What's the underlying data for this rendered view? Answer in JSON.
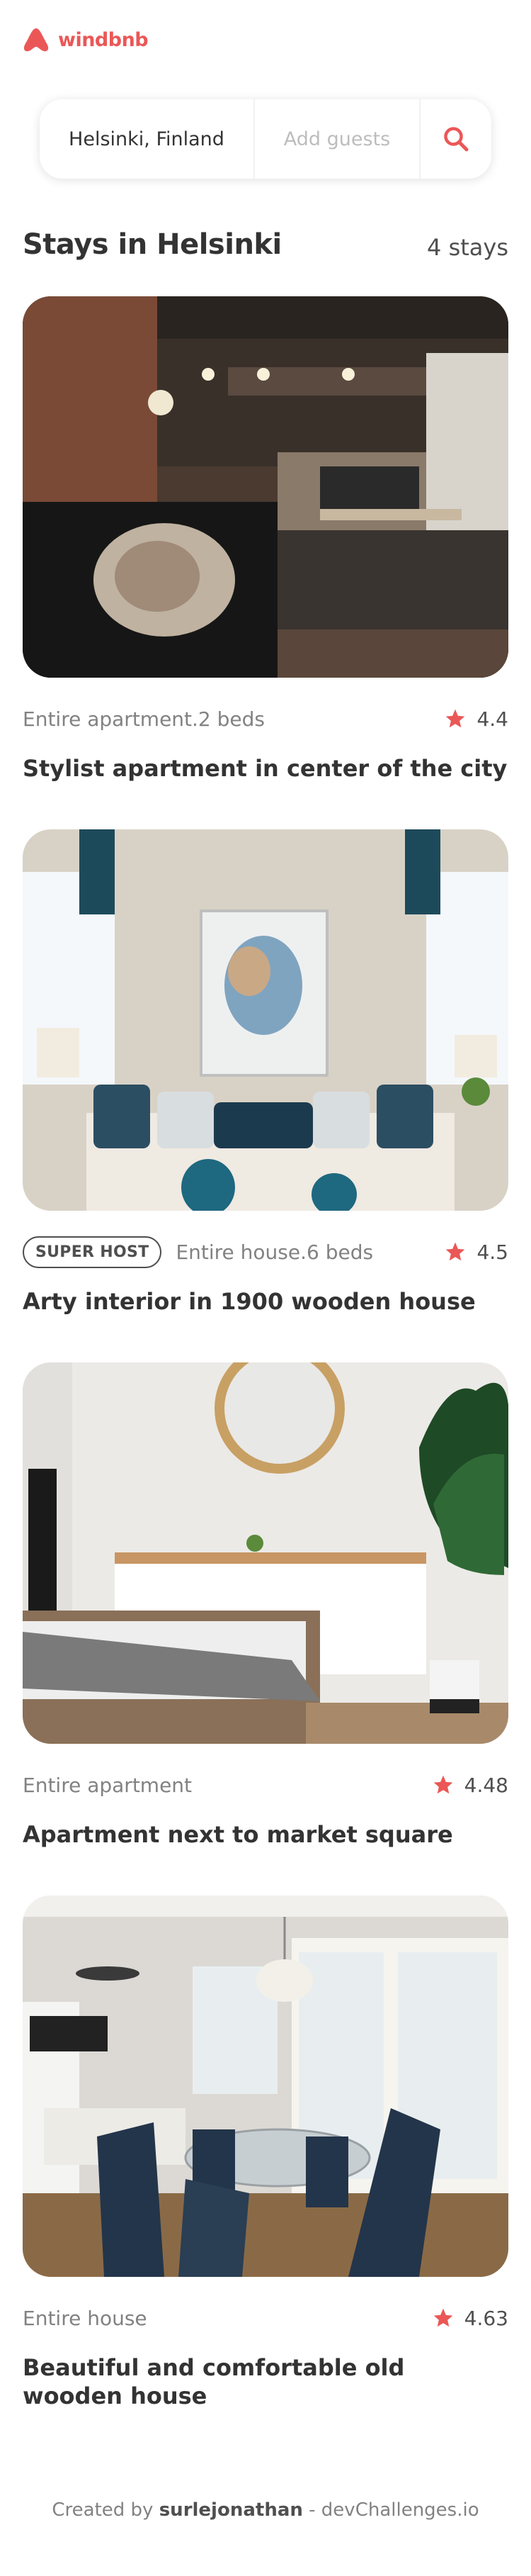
{
  "app": {
    "name": "windbnb"
  },
  "search": {
    "location": "Helsinki, Finland",
    "guests_placeholder": "Add guests"
  },
  "heading": {
    "title": "Stays in Helsinki",
    "count": "4 stays"
  },
  "stays": [
    {
      "superhost": false,
      "type": "Entire apartment.2 beds",
      "rating": "4.4",
      "title": "Stylist apartment in center of the city"
    },
    {
      "superhost": true,
      "superhost_label": "SUPER HOST",
      "type": "Entire house.6 beds",
      "rating": "4.5",
      "title": "Arty interior in 1900 wooden house"
    },
    {
      "superhost": false,
      "type": "Entire apartment",
      "rating": "4.48",
      "title": "Apartment next to market square"
    },
    {
      "superhost": false,
      "type": "Entire house",
      "rating": "4.63",
      "title": "Beautiful and comfortable old wooden house"
    }
  ],
  "footer": {
    "prefix": "Created by",
    "author": "surlejonathan",
    "suffix": "- devChallenges.io"
  },
  "colors": {
    "accent": "#eb5757"
  },
  "icons": {
    "logo": "windbnb-logo-icon",
    "search": "search-icon",
    "rating": "star-icon"
  }
}
